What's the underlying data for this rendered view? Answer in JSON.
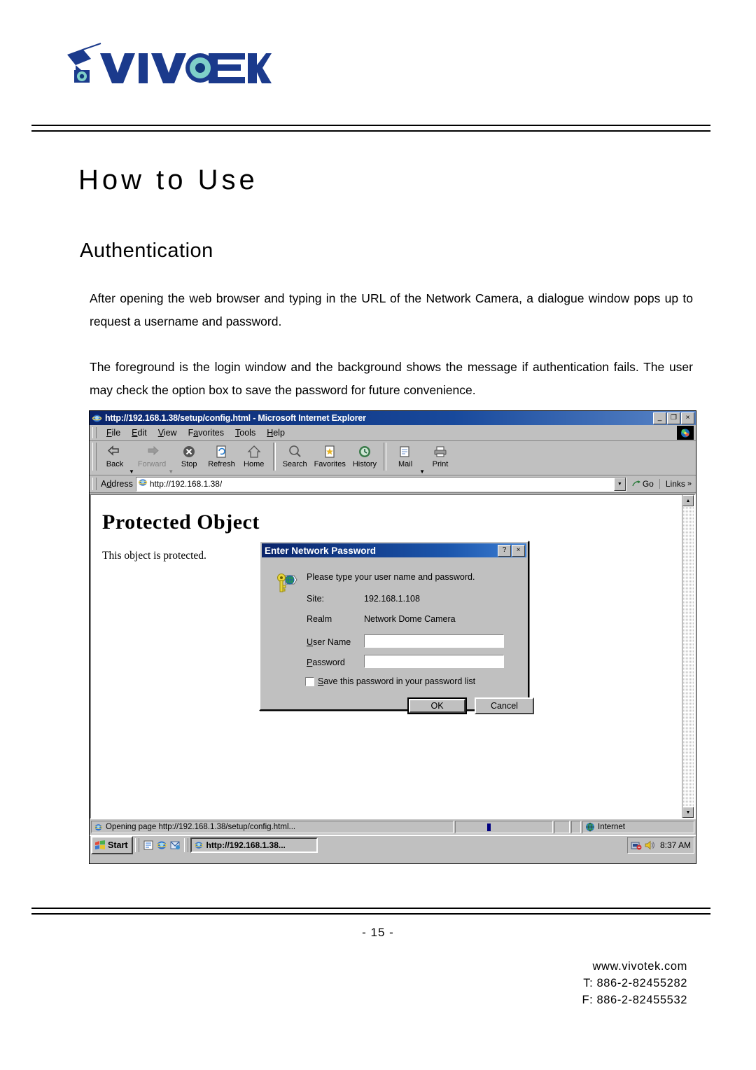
{
  "document": {
    "brand": "VIVOTEK",
    "chapter_title": "How to Use",
    "section_title": "Authentication",
    "paragraph_1": "After opening the web browser and typing in the URL of the Network Camera, a dialogue window pops up to request a username and password.",
    "paragraph_2": "The foreground is the login window and the background shows the message if authentication fails. The user may check the option box to save the password for future convenience.",
    "page_number": "- 15 -",
    "footer": {
      "website": "www.vivotek.com",
      "phone": "T: 886-2-82455282",
      "fax": "F: 886-2-82455532"
    }
  },
  "browser": {
    "title": "http://192.168.1.38/setup/config.html - Microsoft Internet Explorer",
    "window_buttons": {
      "minimize": "_",
      "restore": "❐",
      "close": "×"
    },
    "menu": [
      {
        "label": "File",
        "accel": "F"
      },
      {
        "label": "Edit",
        "accel": "E"
      },
      {
        "label": "View",
        "accel": "V"
      },
      {
        "label": "Favorites",
        "accel": "a"
      },
      {
        "label": "Tools",
        "accel": "T"
      },
      {
        "label": "Help",
        "accel": "H"
      }
    ],
    "toolbar": [
      {
        "label": "Back",
        "icon": "back-arrow-icon",
        "disabled": false,
        "dropdown": true
      },
      {
        "label": "Forward",
        "icon": "forward-arrow-icon",
        "disabled": true,
        "dropdown": true
      },
      {
        "label": "Stop",
        "icon": "stop-icon",
        "disabled": false,
        "dropdown": false
      },
      {
        "label": "Refresh",
        "icon": "refresh-icon",
        "disabled": false,
        "dropdown": false
      },
      {
        "label": "Home",
        "icon": "home-icon",
        "disabled": false,
        "dropdown": false
      },
      {
        "label": "Search",
        "icon": "search-icon",
        "disabled": false,
        "dropdown": false
      },
      {
        "label": "Favorites",
        "icon": "favorites-icon",
        "disabled": false,
        "dropdown": false
      },
      {
        "label": "History",
        "icon": "history-icon",
        "disabled": false,
        "dropdown": false
      },
      {
        "label": "Mail",
        "icon": "mail-icon",
        "disabled": false,
        "dropdown": true
      },
      {
        "label": "Print",
        "icon": "print-icon",
        "disabled": false,
        "dropdown": false
      }
    ],
    "address": {
      "label": "Address",
      "url": "http://192.168.1.38/",
      "go_label": "Go",
      "links_label": "Links"
    },
    "page": {
      "heading": "Protected Object",
      "text": "This object is protected."
    },
    "status": {
      "message": "Opening page http://192.168.1.38/setup/config.html...",
      "zone": "Internet"
    }
  },
  "dialog": {
    "title": "Enter Network Password",
    "prompt": "Please type your user name and password.",
    "site_label": "Site:",
    "site_value": "192.168.1.108",
    "realm_label": "Realm",
    "realm_value": "Network Dome Camera",
    "username_label": "User Name",
    "username_value": "",
    "password_label": "Password",
    "password_value": "",
    "save_checkbox_label": "Save this password in your password list",
    "save_checked": false,
    "ok_label": "OK",
    "cancel_label": "Cancel",
    "help_button": "?",
    "close_button": "×"
  },
  "taskbar": {
    "start_label": "Start",
    "task_button_label": "http://192.168.1.38...",
    "clock": "8:37 AM"
  },
  "colors": {
    "brand_blue": "#1b3a8c",
    "titlebar_blue": "#0a246a",
    "window_face": "#c0c0c0"
  }
}
